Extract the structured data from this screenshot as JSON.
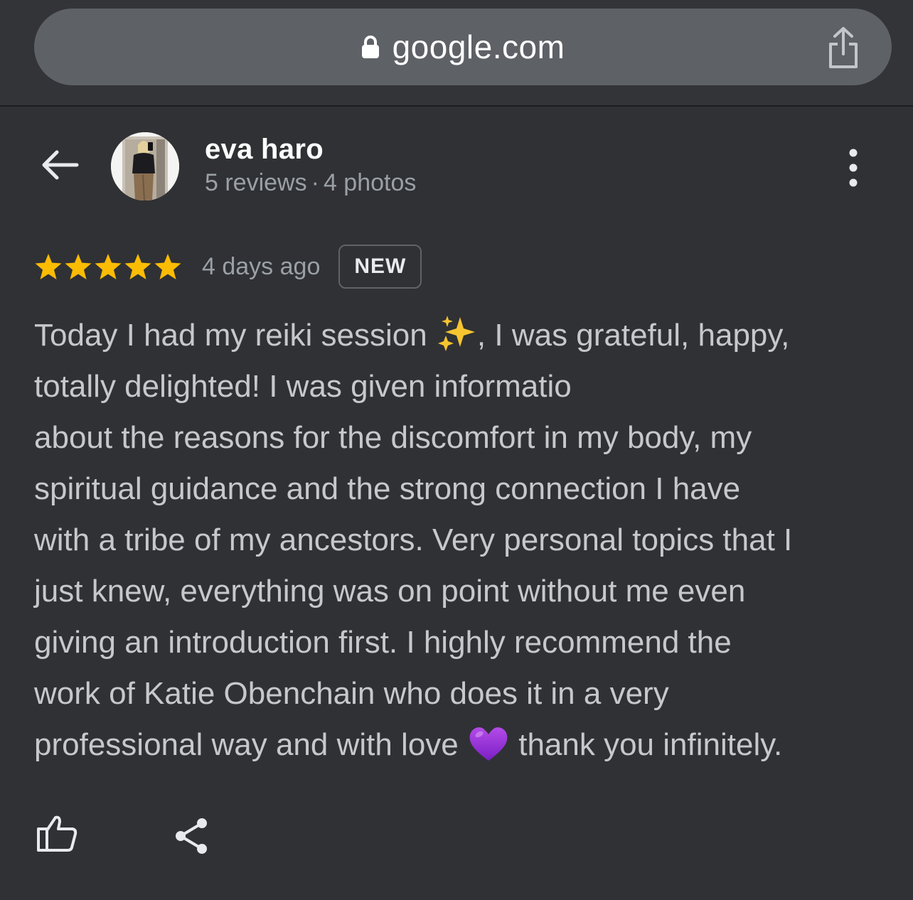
{
  "browser": {
    "url": "google.com",
    "lock_icon": "lock-icon",
    "share_icon": "share-upload-icon"
  },
  "reviewer": {
    "name": "eva haro",
    "reviews": "5 reviews",
    "separator": "·",
    "photos": "4 photos",
    "avatar": "profile-photo"
  },
  "review": {
    "rating": 5,
    "rating_max": 5,
    "star_color": "#fbbc04",
    "age": "4 days ago",
    "badge": "NEW",
    "lines": [
      [
        "Today I had my reiki session ",
        ", I was grateful, happy,"
      ],
      "totally delighted! I was given informatio",
      "about the reasons for the discomfort in my body, my",
      "spiritual guidance and the strong connection I have",
      "with a tribe of my ancestors. Very personal topics that I",
      "just knew, everything was on point without me even",
      "giving an introduction first. I highly recommend the",
      "work of Katie Obenchain who does it in a very",
      [
        "professional way and with love ",
        " thank you infinitely."
      ]
    ],
    "emoji_1": "sparkles",
    "emoji_2": "purple-heart"
  },
  "actions": {
    "like": "thumbs-up-icon",
    "share": "share-icon"
  },
  "colors": {
    "background": "#303134",
    "url_pill": "#5e6166",
    "text_primary": "#ffffff",
    "text_secondary": "#9aa0a6",
    "text_body": "#c6c8cb"
  }
}
